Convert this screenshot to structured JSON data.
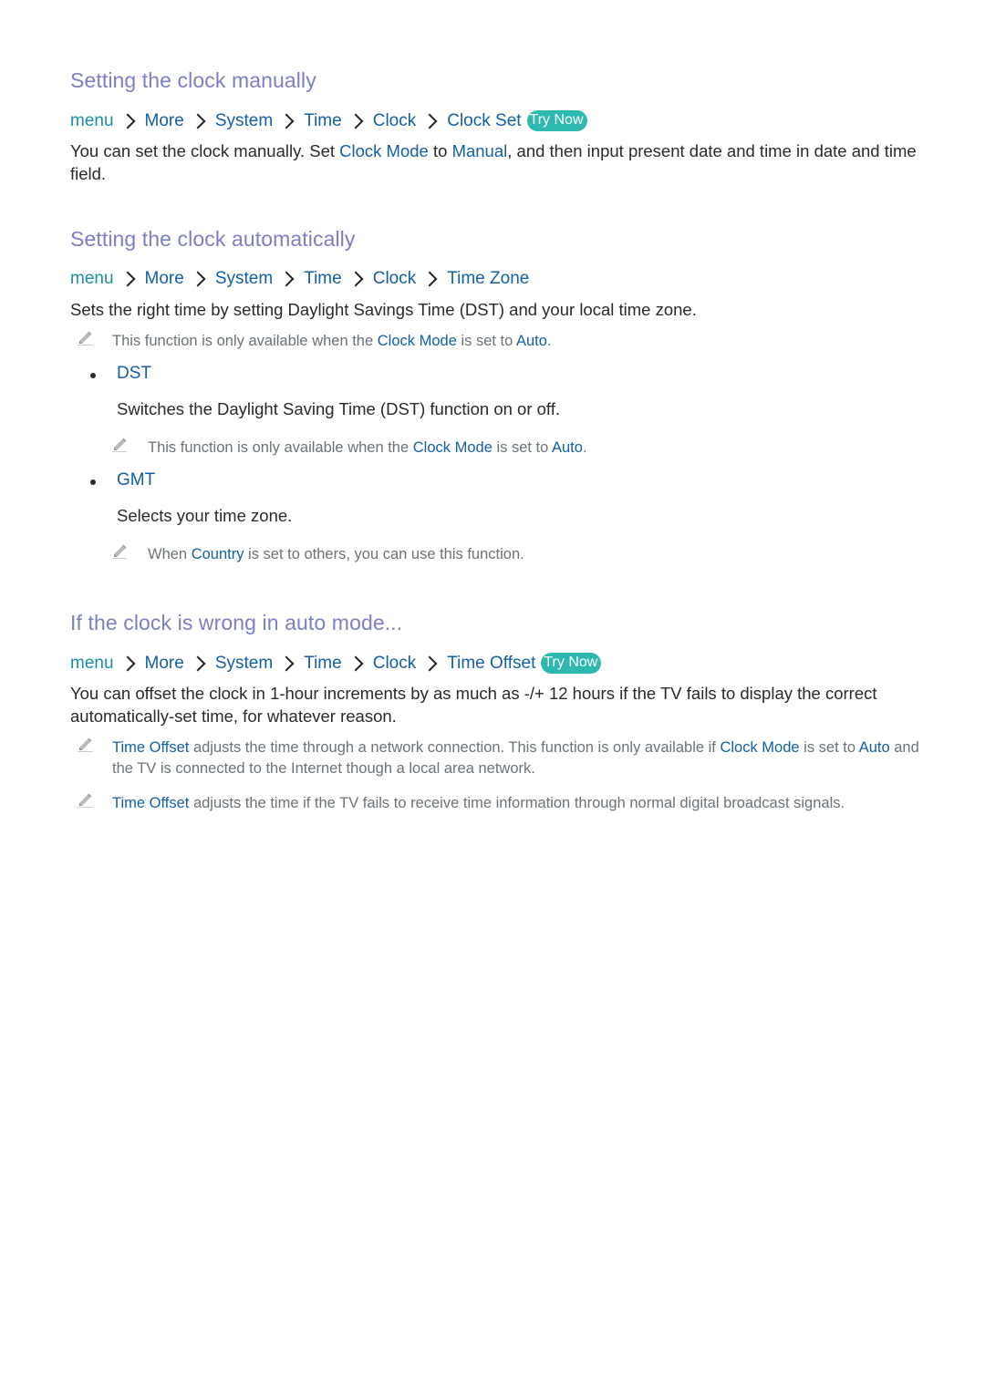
{
  "sections": [
    {
      "heading": "Setting the clock manually",
      "path": {
        "root": "menu",
        "segments": [
          "More",
          "System",
          "Time",
          "Clock",
          "Clock Set"
        ],
        "try_now": "Try Now"
      },
      "paragraph": {
        "p1": "You can set the clock manually. Set ",
        "h1": "Clock Mode",
        "p2": " to ",
        "h2": "Manual",
        "p3": ", and then input present date and time in date and time field."
      }
    },
    {
      "heading": "Setting the clock automatically",
      "path": {
        "root": "menu",
        "segments": [
          "More",
          "System",
          "Time",
          "Clock",
          "Time Zone"
        ]
      },
      "paragraph": "Sets the right time by setting Daylight Savings Time (DST) and your local time zone.",
      "note": {
        "p1": "This function is only available when the ",
        "h1": "Clock Mode",
        "p2": " is set to ",
        "h2": "Auto",
        "p3": "."
      },
      "items": [
        {
          "title": "DST",
          "description": "Switches the Daylight Saving Time (DST) function on or off.",
          "note": {
            "p1": "This function is only available when the ",
            "h1": "Clock Mode",
            "p2": " is set to ",
            "h2": "Auto",
            "p3": "."
          }
        },
        {
          "title": "GMT",
          "description": "Selects your time zone.",
          "note": {
            "p1": "When ",
            "h1": "Country",
            "p2": " is set to others, you can use this function."
          }
        }
      ]
    },
    {
      "heading": "If the clock is wrong in auto mode...",
      "path": {
        "root": "menu",
        "segments": [
          "More",
          "System",
          "Time",
          "Clock",
          "Time Offset"
        ],
        "try_now": "Try Now"
      },
      "paragraph": "You can offset the clock in 1-hour increments by as much as -/+ 12 hours if the TV fails to display the correct automatically-set time, for whatever reason.",
      "notes": [
        {
          "h1": "Time Offset",
          "p1": " adjusts the time through a network connection. This function is only available if ",
          "h2": "Clock Mode",
          "p2": " is set to ",
          "h3": "Auto",
          "p3": " and the TV is connected to the Internet though a local area network."
        },
        {
          "h1": "Time Offset",
          "p1": " adjusts the time if the TV fails to receive time information through normal digital broadcast signals."
        }
      ]
    }
  ],
  "colors": {
    "heading": "#7b7fc4",
    "menu": "#1a8fa2",
    "link": "#1360a6",
    "try_now_bg": "#2eb9b0",
    "body": "#2a2a2a",
    "note": "#6b7378"
  }
}
